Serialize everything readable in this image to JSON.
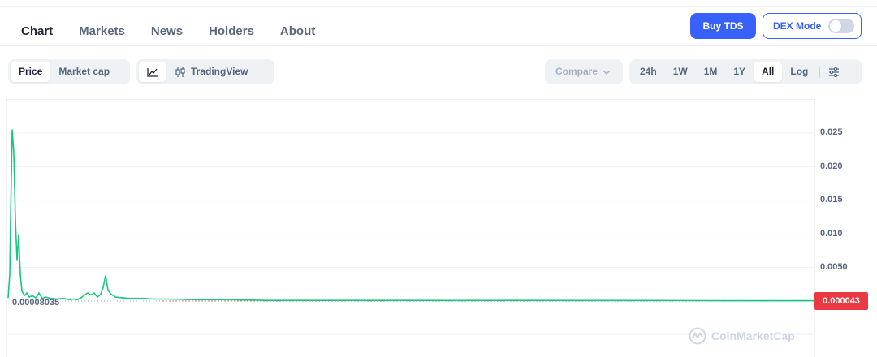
{
  "tabs": [
    "Chart",
    "Markets",
    "News",
    "Holders",
    "About"
  ],
  "buy_label": "Buy TDS",
  "dex_label": "DEX Mode",
  "view_toggle": [
    "Price",
    "Market cap"
  ],
  "chart_style": {
    "tradingview_label": "TradingView"
  },
  "compare_label": "Compare",
  "ranges": [
    "24h",
    "1W",
    "1M",
    "1Y",
    "All"
  ],
  "log_label": "Log",
  "current_price": "0.000043",
  "min_label": "0.00008035",
  "watermark": "CoinMarketCap",
  "colors": {
    "accent": "#3861fb",
    "line": "#16c784",
    "flag": "#ea3943"
  },
  "chart_data": {
    "type": "line",
    "yticks": [
      "0.025",
      "0.020",
      "0.015",
      "0.010",
      "0.0050"
    ],
    "ylim": [
      0,
      0.029
    ],
    "series": [
      {
        "values": [
          0.0005,
          0.004,
          0.012,
          0.0255,
          0.022,
          0.012,
          0.006,
          0.0098,
          0.004,
          0.0015,
          0.0008,
          0.0012,
          0.0006,
          0.0008,
          0.0005,
          0.0012,
          0.0004,
          0.0006,
          0.0004,
          0.0003,
          0.0004,
          0.0002,
          0.0003,
          0.0002,
          0.0005,
          0.0009,
          0.0012,
          0.0009,
          0.0012,
          0.0006,
          0.001,
          0.002,
          0.0038,
          0.0016,
          0.001,
          0.0006,
          0.0005,
          0.0004,
          0.0004,
          0.0003,
          0.0003,
          0.0002,
          0.0002,
          0.0001,
          0.0001,
          0.0001,
          8e-05,
          0.0001,
          8e-05,
          9e-05,
          6e-05,
          5e-05,
          4.3e-05
        ]
      }
    ]
  }
}
